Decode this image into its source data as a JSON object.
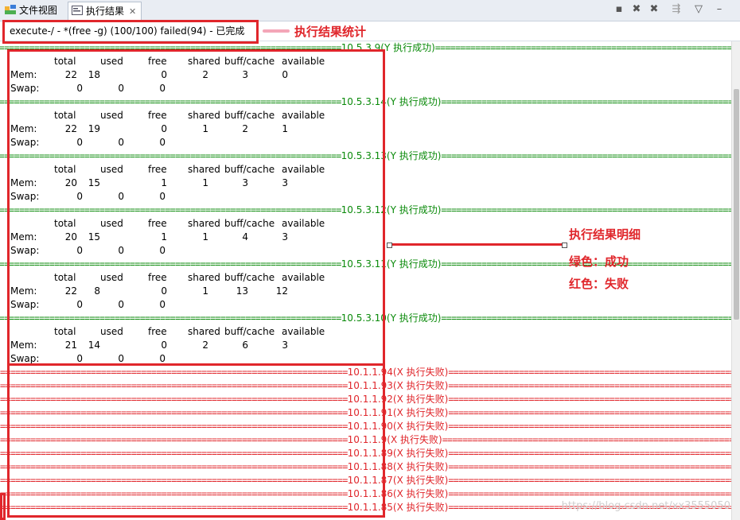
{
  "tabs": [
    {
      "label": "文件视图",
      "icon": "folder-view-icon"
    },
    {
      "label": "执行结果",
      "icon": "console-icon",
      "close": "✕"
    }
  ],
  "toolbar": [
    "minimize-icon",
    "remove-icon",
    "remove-all-icon",
    "pin-icon",
    "view-menu-icon"
  ],
  "status": "execute-/ - *(free -g) (100/100) failed(94)  - 已完成",
  "header_cols": [
    "total",
    "used",
    "free",
    "shared",
    "buff/cache",
    "available"
  ],
  "row_labels": {
    "mem": "Mem:",
    "swap": "Swap:"
  },
  "success_blocks": [
    {
      "sep": "10.5.3.9(Y 执行成功)",
      "mem": [
        "22",
        "18",
        "0",
        "2",
        "3",
        "0"
      ],
      "swap": [
        "0",
        "0",
        "0"
      ]
    },
    {
      "sep": "10.5.3.14(Y 执行成功)",
      "mem": [
        "22",
        "19",
        "0",
        "1",
        "2",
        "1"
      ],
      "swap": [
        "0",
        "0",
        "0"
      ]
    },
    {
      "sep": "10.5.3.13(Y 执行成功)",
      "mem": [
        "20",
        "15",
        "1",
        "1",
        "3",
        "3"
      ],
      "swap": [
        "0",
        "0",
        "0"
      ]
    },
    {
      "sep": "10.5.3.12(Y 执行成功)",
      "mem": [
        "20",
        "15",
        "1",
        "1",
        "4",
        "3"
      ],
      "swap": [
        "0",
        "0",
        "0"
      ]
    },
    {
      "sep": "10.5.3.11(Y 执行成功)",
      "mem": [
        "22",
        "8",
        "0",
        "1",
        "13",
        "12"
      ],
      "swap": [
        "0",
        "0",
        "0"
      ]
    },
    {
      "sep": "10.5.3.10(Y 执行成功)",
      "mem": [
        "21",
        "14",
        "0",
        "2",
        "6",
        "3"
      ],
      "swap": [
        "0",
        "0",
        "0"
      ]
    }
  ],
  "fail_lines": [
    "10.1.1.94(X 执行失败)",
    "10.1.1.93(X 执行失败)",
    "10.1.1.92(X 执行失败)",
    "10.1.1.91(X 执行失败)",
    "10.1.1.90(X 执行失败)",
    "10.1.1.9(X 执行失败)",
    "10.1.1.89(X 执行失败)",
    "10.1.1.88(X 执行失败)",
    "10.1.1.87(X 执行失败)",
    "10.1.1.86(X 执行失败)",
    "10.1.1.85(X 执行失败)"
  ],
  "annotations": {
    "summary": "执行结果统计",
    "detail": "执行结果明细",
    "green": "绿色：成功",
    "red": "红色：失败"
  },
  "colors": {
    "success": "#0a8a0a",
    "fail": "#e0262b",
    "highlight": "#e0262b"
  },
  "watermark": "https://blog.csdn.net/xx3555050"
}
